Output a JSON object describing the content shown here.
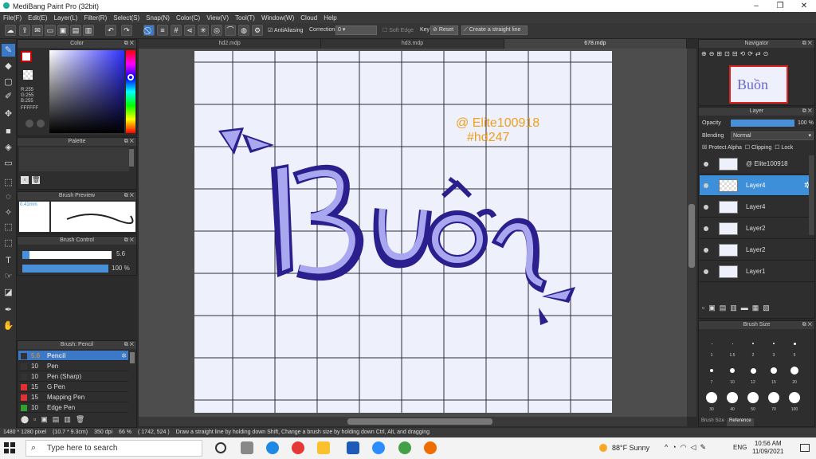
{
  "app": {
    "title": "MediBang Paint Pro (32bit)"
  },
  "menu": [
    "File(F)",
    "Edit(E)",
    "Layer(L)",
    "Filter(R)",
    "Select(S)",
    "Snap(N)",
    "Color(C)",
    "View(V)",
    "Tool(T)",
    "Window(W)",
    "Cloud",
    "Help"
  ],
  "toolbar": {
    "antialiasing": "AntiAliasing",
    "correction_label": "Correction",
    "correction_value": "0",
    "soft_edge": "Soft Edge",
    "key_label": "Key",
    "reset": "Reset",
    "straight_line": "Create a straight line"
  },
  "tabs": [
    "hd2.mdp",
    "hd3.mdp",
    "678.mdp"
  ],
  "color_panel": {
    "title": "Color",
    "r": "R:255",
    "g": "G:255",
    "b": "B:255",
    "hex": "FFFFFF"
  },
  "palette_panel": {
    "title": "Palette"
  },
  "brush_preview": {
    "title": "Brush Preview",
    "size": "0.41mm"
  },
  "brush_control": {
    "title": "Brush Control",
    "size": "5.6",
    "opacity": "100 %",
    "opacity_fill": 1.0
  },
  "brush_list": {
    "title": "Brush: Pencil",
    "items": [
      {
        "size": "5.6",
        "name": "Pencil",
        "color": "#333333",
        "selected": true
      },
      {
        "size": "10",
        "name": "Pen",
        "color": "#333333"
      },
      {
        "size": "10",
        "name": "Pen (Sharp)",
        "color": "#333333"
      },
      {
        "size": "15",
        "name": "G Pen",
        "color": "#e03030"
      },
      {
        "size": "15",
        "name": "Mapping Pen",
        "color": "#e03030"
      },
      {
        "size": "10",
        "name": "Edge Pen",
        "color": "#30a030"
      }
    ]
  },
  "navigator": {
    "title": "Navigator"
  },
  "layer_panel": {
    "title": "Layer",
    "opacity_label": "Opacity",
    "opacity_value": "100 %",
    "blending_label": "Blending",
    "blending_value": "Normal",
    "protect_alpha": "Protect Alpha",
    "clipping": "Clipping",
    "lock": "Lock",
    "layers": [
      {
        "name": "@ Elite100918",
        "selected": false
      },
      {
        "name": "Layer4",
        "selected": true
      },
      {
        "name": "Layer4",
        "selected": false
      },
      {
        "name": "Layer2",
        "selected": false
      },
      {
        "name": "Layer2",
        "selected": false
      },
      {
        "name": "Layer1",
        "selected": false
      }
    ]
  },
  "brush_size": {
    "title": "Brush Size",
    "rows": [
      [
        "1",
        "1.5",
        "2",
        "3",
        "5"
      ],
      [
        "7",
        "10",
        "12",
        "15",
        "20"
      ],
      [
        "30",
        "40",
        "50",
        "70",
        "100"
      ]
    ],
    "tabs": [
      "Brush Size",
      "Reference"
    ]
  },
  "canvas": {
    "watermark_line1": "@ Elite100918",
    "watermark_line2": "#hd247",
    "text": "Buồn",
    "colors": {
      "dark": "#2a1f8c",
      "light": "#a9a7f0",
      "bg": "#eef0fb",
      "grid": "#2d2d3d",
      "watermark": "#f0a020"
    }
  },
  "status": {
    "size": "1480 * 1280 pixel",
    "dims": "(10.7 * 9.3cm)",
    "dpi": "350 dpi",
    "zoom": "66 %",
    "coords": "( 1742, 524 )",
    "hint": "Draw a straight line by holding down Shift, Change a brush size by holding down Ctrl, Alt, and dragging"
  },
  "taskbar": {
    "search": "Type here to search",
    "weather": "88°F  Sunny",
    "lang": "ENG",
    "time": "10:56 AM",
    "date": "11/09/2021"
  }
}
